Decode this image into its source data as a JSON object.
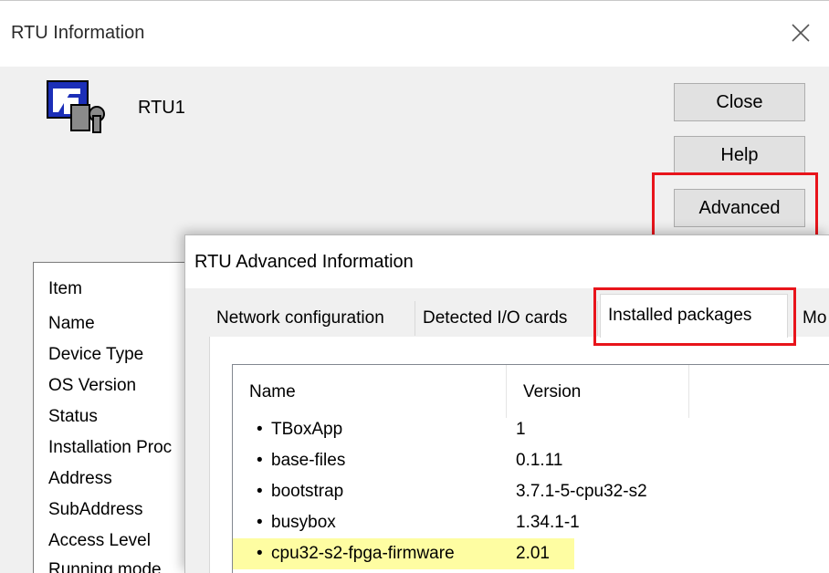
{
  "window": {
    "title": "RTU Information",
    "device_name": "RTU1",
    "buttons": {
      "close": "Close",
      "help": "Help",
      "advanced": "Advanced"
    },
    "item_list": {
      "header": "Item",
      "rows": [
        "Name",
        "Device Type",
        "OS Version",
        "Status",
        "Installation Proc",
        "Address",
        "SubAddress",
        "Access Level",
        "Running mode"
      ]
    }
  },
  "advanced_dialog": {
    "title": "RTU Advanced Information",
    "tabs": [
      "Network configuration",
      "Detected I/O cards",
      "Installed packages",
      "Mo"
    ],
    "active_tab": "Installed packages",
    "packages": {
      "columns": [
        "Name",
        "Version"
      ],
      "rows": [
        {
          "name": "TBoxApp",
          "version": "1"
        },
        {
          "name": "base-files",
          "version": "0.1.11"
        },
        {
          "name": "bootstrap",
          "version": "3.7.1-5-cpu32-s2"
        },
        {
          "name": "busybox",
          "version": "1.34.1-1"
        },
        {
          "name": "cpu32-s2-fpga-firmware",
          "version": "2.01"
        }
      ]
    }
  },
  "colors": {
    "highlight_red": "#e8141b",
    "selected_row": "#fefda2"
  },
  "icons": {
    "app": "rtu-app-icon",
    "close": "close-icon",
    "bullet": "bullet-icon"
  }
}
